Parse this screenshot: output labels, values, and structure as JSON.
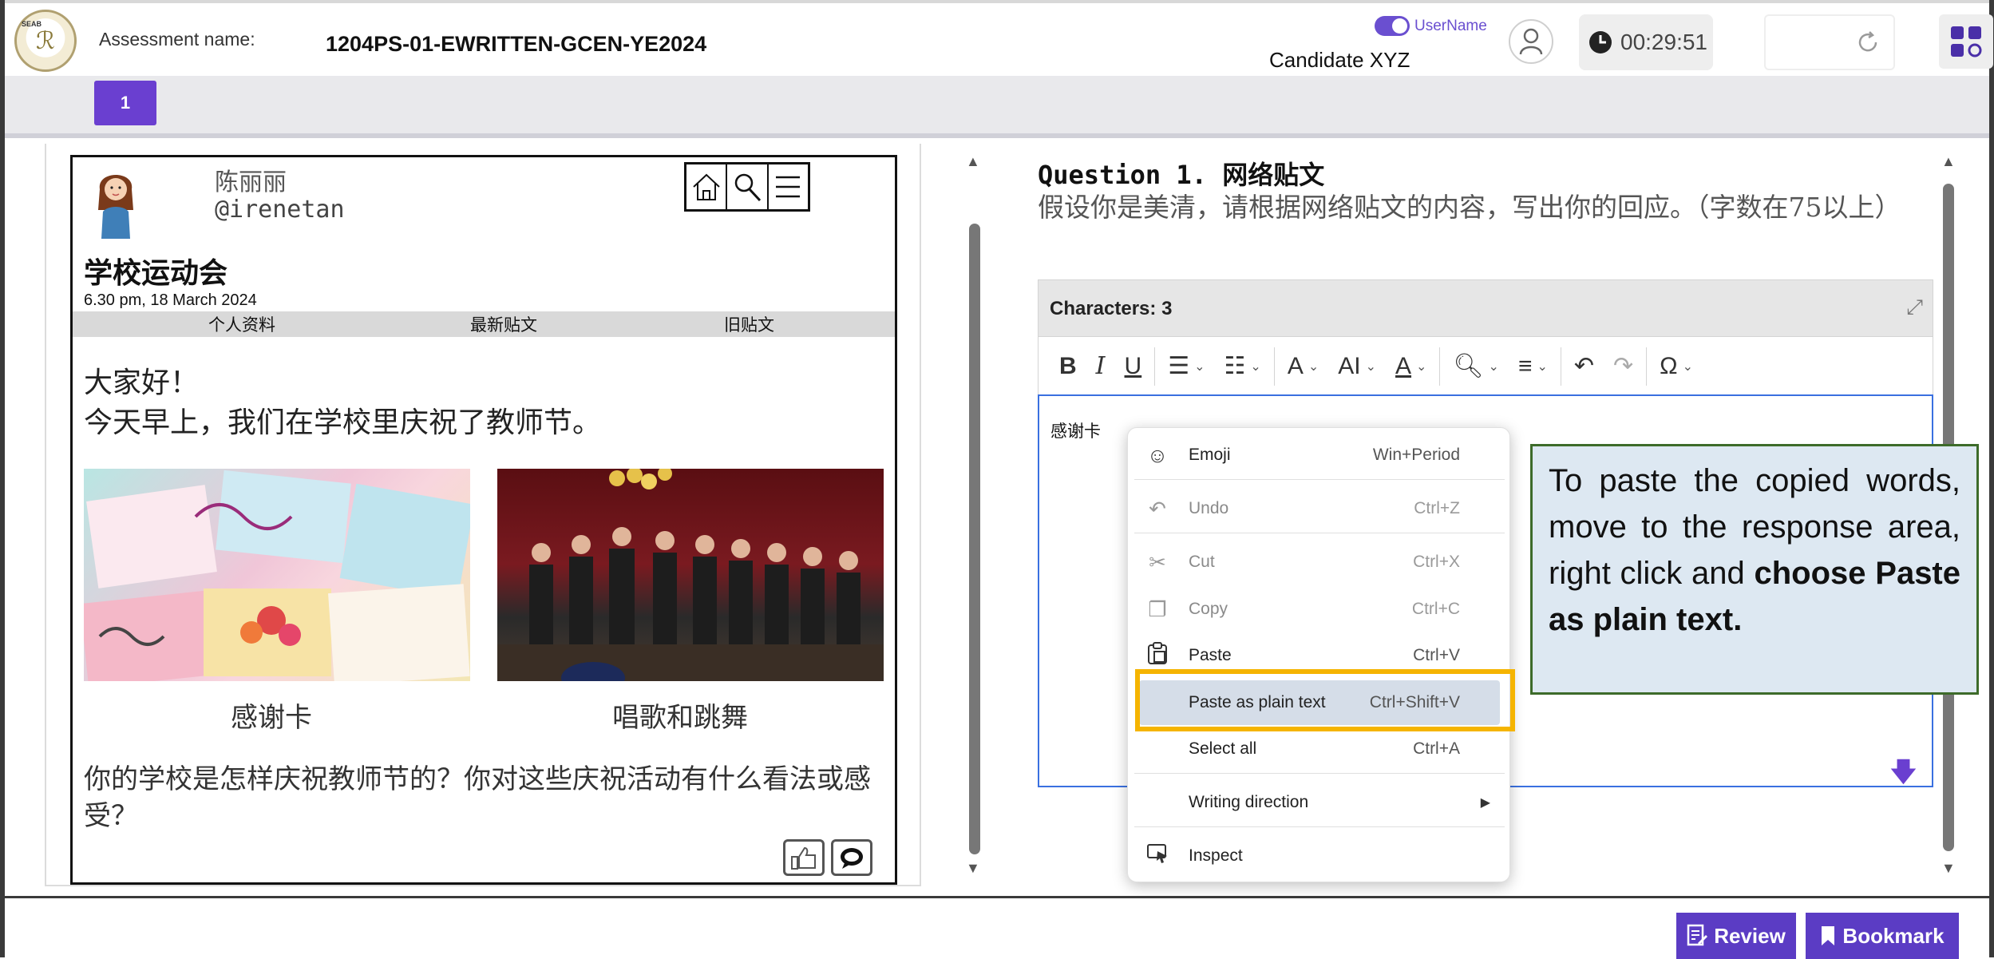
{
  "header": {
    "assessment_label": "Assessment name:",
    "assessment_name": "1204PS-01-EWRITTEN-GCEN-YE2024",
    "username_toggle_label": "UserName",
    "candidate": "Candidate XYZ",
    "timer": "00:29:51",
    "logo_text": "SEAB"
  },
  "nav": {
    "pages": [
      "1"
    ]
  },
  "post": {
    "author": "陈丽丽",
    "handle": "@irenetan",
    "title": "学校运动会",
    "date": "6.30 pm, 18 March 2024",
    "tabs": [
      "个人资料",
      "最新贴文",
      "旧贴文"
    ],
    "greeting_line1": "大家好！",
    "greeting_line2": "今天早上，我们在学校里庆祝了教师节。",
    "caption1": "感谢卡",
    "caption2": "唱歌和跳舞",
    "question": "你的学校是怎样庆祝教师节的？你对这些庆祝活动有什么看法或感受？"
  },
  "question": {
    "number_label": "Question 1.",
    "title": "网络贴文",
    "body": "假设你是美清，请根据网络贴文的内容，写出你的回应。（字数在75以上）"
  },
  "editor": {
    "char_count_label": "Characters: 3",
    "content": "感谢卡"
  },
  "context_menu": {
    "items": [
      {
        "label": "Emoji",
        "shortcut": "Win+Period",
        "icon": "smiley-icon",
        "glyph": "☺",
        "disabled": false
      },
      {
        "label": "Undo",
        "shortcut": "Ctrl+Z",
        "icon": "undo-icon",
        "glyph": "↶",
        "disabled": true
      },
      {
        "label": "Cut",
        "shortcut": "Ctrl+X",
        "icon": "scissors-icon",
        "glyph": "✂",
        "disabled": true
      },
      {
        "label": "Copy",
        "shortcut": "Ctrl+C",
        "icon": "copy-icon",
        "glyph": "❐",
        "disabled": true
      },
      {
        "label": "Paste",
        "shortcut": "Ctrl+V",
        "icon": "clipboard-icon",
        "glyph": "📋",
        "disabled": false
      },
      {
        "label": "Paste as plain text",
        "shortcut": "Ctrl+Shift+V",
        "icon": "",
        "glyph": "",
        "disabled": false
      },
      {
        "label": "Select all",
        "shortcut": "Ctrl+A",
        "icon": "",
        "glyph": "",
        "disabled": false
      },
      {
        "label": "Writing direction",
        "shortcut": "",
        "icon": "",
        "glyph": "",
        "disabled": false
      },
      {
        "label": "Inspect",
        "shortcut": "",
        "icon": "inspect-icon",
        "glyph": "⬚",
        "disabled": false
      }
    ]
  },
  "callout": {
    "text_plain": "To paste the copied words, move to the response area, right click and ",
    "text_bold": "choose Paste as plain text."
  },
  "footer": {
    "review_label": "Review",
    "bookmark_label": "Bookmark"
  },
  "colors": {
    "accent": "#5b3cc4",
    "highlight": "#f5b400",
    "callout_bg": "#dde8f2",
    "callout_border": "#3d6b2a"
  }
}
